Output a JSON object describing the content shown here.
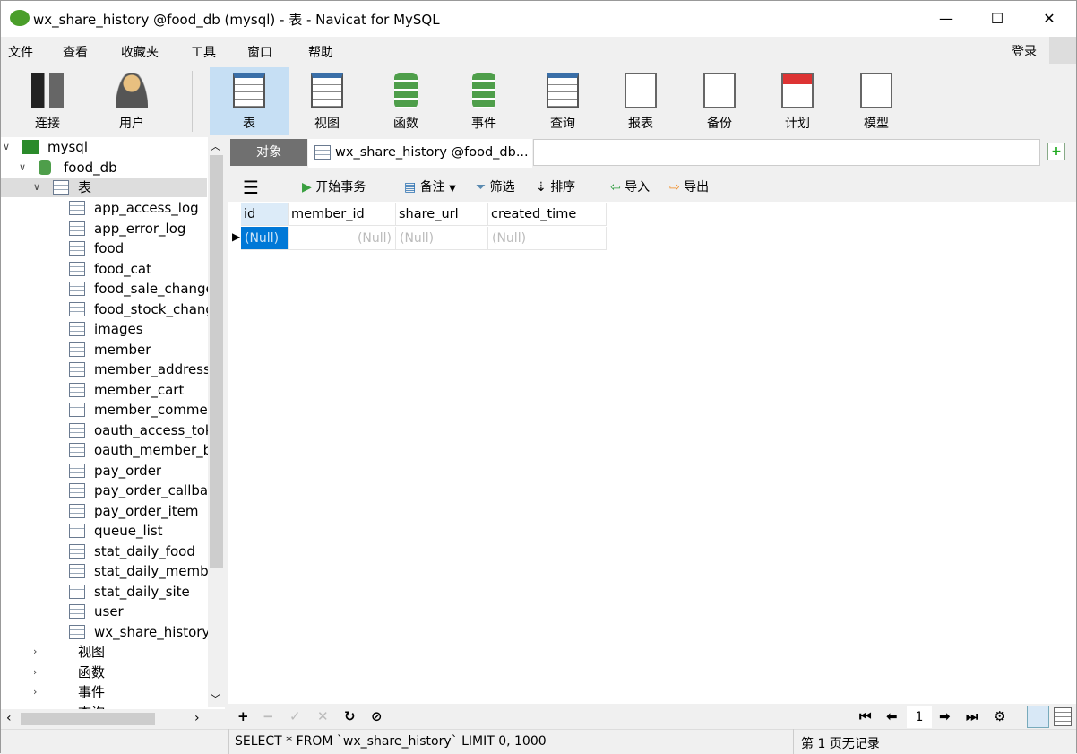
{
  "window": {
    "title": "wx_share_history @food_db (mysql) - 表 - Navicat for MySQL",
    "minimize": "—",
    "maximize": "☐",
    "close": "✕"
  },
  "menu": [
    "文件",
    "查看",
    "收藏夹",
    "工具",
    "窗口",
    "帮助"
  ],
  "login": "登录",
  "toolbar": [
    {
      "label": "连接",
      "icon": "connection-icon"
    },
    {
      "label": "用户",
      "icon": "user-icon"
    },
    {
      "label": "表",
      "icon": "table-icon",
      "selected": true
    },
    {
      "label": "视图",
      "icon": "view-icon"
    },
    {
      "label": "函数",
      "icon": "function-icon"
    },
    {
      "label": "事件",
      "icon": "event-icon"
    },
    {
      "label": "查询",
      "icon": "query-icon"
    },
    {
      "label": "报表",
      "icon": "report-icon"
    },
    {
      "label": "备份",
      "icon": "backup-icon"
    },
    {
      "label": "计划",
      "icon": "schedule-icon"
    },
    {
      "label": "模型",
      "icon": "model-icon"
    }
  ],
  "tree": {
    "connection": "mysql",
    "database": "food_db",
    "tables_label": "表",
    "tables": [
      "app_access_log",
      "app_error_log",
      "food",
      "food_cat",
      "food_sale_change",
      "food_stock_chang",
      "images",
      "member",
      "member_address",
      "member_cart",
      "member_commer",
      "oauth_access_tok",
      "oauth_member_b",
      "pay_order",
      "pay_order_callbac",
      "pay_order_item",
      "queue_list",
      "stat_daily_food",
      "stat_daily_membe",
      "stat_daily_site",
      "user",
      "wx_share_history"
    ],
    "others": [
      "视图",
      "函数",
      "事件",
      "查询"
    ]
  },
  "tabs": {
    "objects": "对象",
    "active": "wx_share_history @food_db..."
  },
  "subtoolbar": {
    "begin_transaction": "开始事务",
    "memo": "备注",
    "filter": "筛选",
    "sort": "排序",
    "import": "导入",
    "export": "导出"
  },
  "grid": {
    "columns": [
      "id",
      "member_id",
      "share_url",
      "created_time"
    ],
    "rows": [
      [
        "(Null)",
        "(Null)",
        "(Null)",
        "(Null)"
      ]
    ]
  },
  "pager": {
    "page": "1"
  },
  "status": {
    "sql": "SELECT * FROM `wx_share_history` LIMIT 0, 1000",
    "page_info": "第 1 页无记录"
  },
  "colors": {
    "accent": "#0078d7",
    "selected_tool": "#c6dff4",
    "objects_tab": "#707070"
  }
}
